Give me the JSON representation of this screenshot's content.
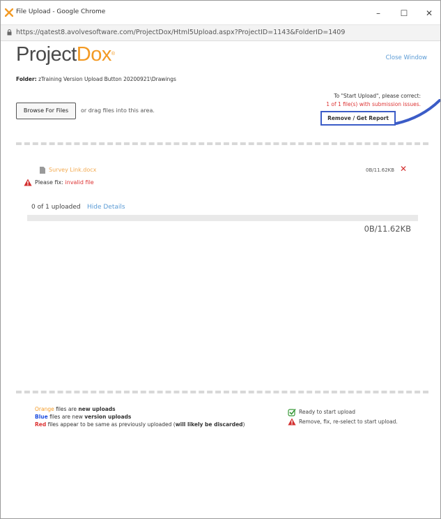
{
  "window": {
    "title": "File Upload - Google Chrome",
    "url": "https://qatest8.avolvesoftware.com/ProjectDox/Html5Upload.aspx?ProjectID=1143&FolderID=1409",
    "controls": [
      "–",
      "☐",
      "✕"
    ]
  },
  "header": {
    "logo_main": "Project",
    "logo_accent": "Dox",
    "logo_mark": "®",
    "close_link": "Close Window"
  },
  "folder": {
    "label": "Folder:",
    "path": "zTraining Version Upload Button 20200921\\Drawings"
  },
  "upload_notice": {
    "line1": "To \"Start Upload\", please correct:",
    "line2": "1 of 1 file(s) with submission issues.",
    "button": "Remove / Get Report"
  },
  "browse": {
    "button": "Browse For Files",
    "drag_hint": "or drag files into this area."
  },
  "file": {
    "name": "Survey Link.docx",
    "size": "0B/11.62KB",
    "fix_prefix": "Please fix:",
    "fix_issue": "invalid file"
  },
  "progress": {
    "count": "0 of 1 uploaded",
    "hide_details": "Hide Details",
    "fraction": 0,
    "text": "0B/11.62KB"
  },
  "legend": {
    "orange_word": "Orange",
    "orange_rest": " files are ",
    "orange_bold": "new uploads",
    "blue_word": "Blue",
    "blue_rest": " files are new ",
    "blue_bold": "version uploads",
    "red_word": "Red",
    "red_rest": " files appear to be same as previously uploaded (",
    "red_bold": "will likely be discarded",
    "red_end": ")",
    "ready": "Ready to start upload",
    "remove_fix": "Remove, fix, re-select to start upload."
  },
  "colors": {
    "accent_orange": "#f39a24",
    "link_blue": "#5b9bd5",
    "error_red": "#d33333",
    "highlight_blue": "#3b5cc7"
  },
  "icons": [
    "app-icon",
    "lock-icon",
    "file-icon",
    "warning-icon",
    "remove-x-icon",
    "check-icon"
  ]
}
